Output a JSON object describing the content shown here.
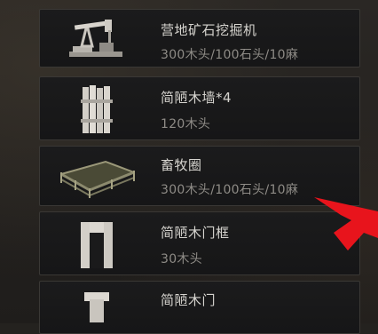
{
  "build_menu": {
    "items": [
      {
        "name": "营地矿石挖掘机",
        "cost": "300木头/100石头/10麻",
        "icon": "ore-drill-icon"
      },
      {
        "name": "简陋木墙*4",
        "cost": "120木头",
        "icon": "wood-wall-icon"
      },
      {
        "name": "畜牧圈",
        "cost": "300木头/100石头/10麻",
        "icon": "livestock-pen-icon"
      },
      {
        "name": "简陋木门框",
        "cost": "30木头",
        "icon": "wood-door-frame-icon"
      },
      {
        "name": "简陋木门",
        "cost": "",
        "icon": "wood-door-icon"
      }
    ]
  },
  "highlight": {
    "arrow_color": "#e8141c"
  }
}
